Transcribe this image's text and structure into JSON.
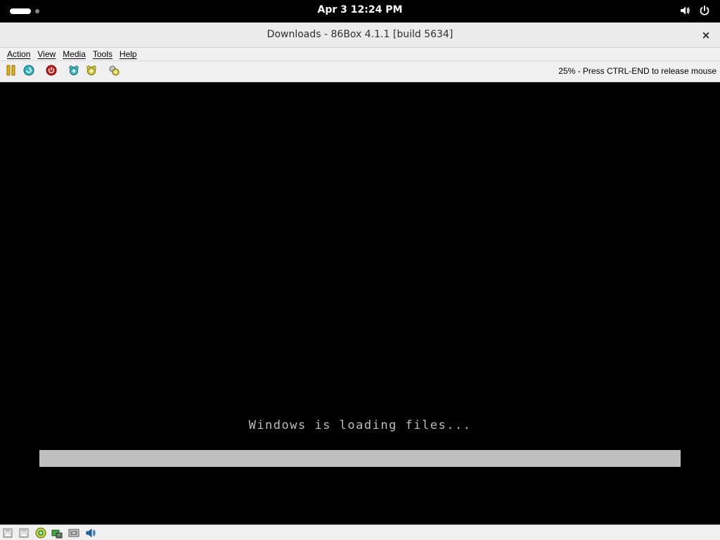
{
  "topbar": {
    "clock": "Apr 3  12:24 PM",
    "icons": [
      "volume-icon",
      "power-icon"
    ]
  },
  "window": {
    "title": "Downloads - 86Box 4.1.1 [build 5634]",
    "close_label": "×"
  },
  "menubar": {
    "items": [
      {
        "label": "Action"
      },
      {
        "label": "View"
      },
      {
        "label": "Media"
      },
      {
        "label": "Tools"
      },
      {
        "label": "Help"
      }
    ]
  },
  "toolbar": {
    "buttons": [
      "pause-icon",
      "reset-icon",
      "power-off-icon",
      "ctrl-alt-del-icon",
      "ctrl-alt-esc-icon",
      "settings-icon"
    ],
    "status": "25% - Press CTRL-END to release mouse"
  },
  "screen": {
    "message": "Windows is loading files...",
    "progress": 1.0,
    "colors": {
      "background": "#000000",
      "text": "#bdbdbd",
      "progress": "#c0c0c0"
    }
  },
  "statusbar": {
    "icons": [
      "floppy-a-icon",
      "floppy-b-icon",
      "cdrom-icon",
      "hard-disk-icon",
      "network-icon",
      "sound-icon"
    ]
  }
}
